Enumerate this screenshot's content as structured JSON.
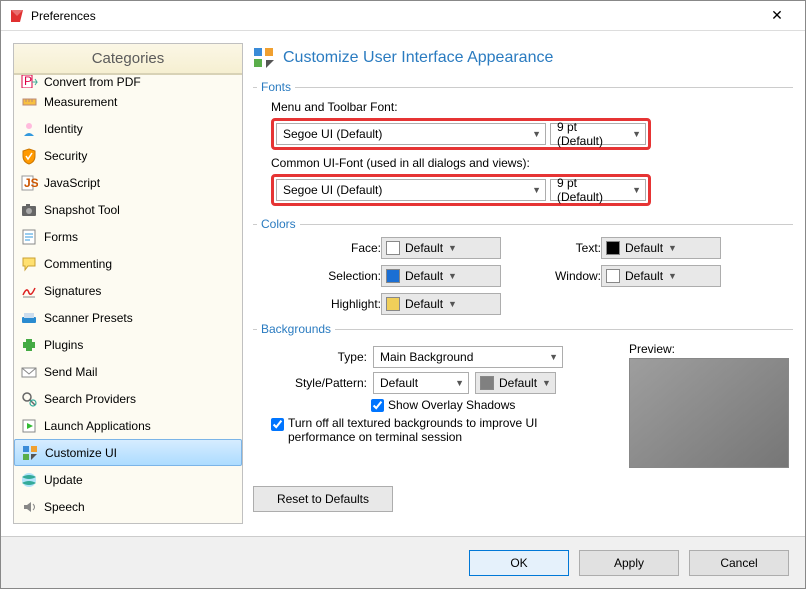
{
  "title": "Preferences",
  "categories_header": "Categories",
  "categories": [
    {
      "id": "convertfrompdf",
      "label": "Convert from PDF",
      "cutoff": true
    },
    {
      "id": "measurement",
      "label": "Measurement"
    },
    {
      "id": "identity",
      "label": "Identity"
    },
    {
      "id": "security",
      "label": "Security"
    },
    {
      "id": "javascript",
      "label": "JavaScript"
    },
    {
      "id": "snapshot",
      "label": "Snapshot Tool"
    },
    {
      "id": "forms",
      "label": "Forms"
    },
    {
      "id": "commenting",
      "label": "Commenting"
    },
    {
      "id": "signatures",
      "label": "Signatures"
    },
    {
      "id": "scanner",
      "label": "Scanner Presets"
    },
    {
      "id": "plugins",
      "label": "Plugins"
    },
    {
      "id": "sendmail",
      "label": "Send Mail"
    },
    {
      "id": "searchproviders",
      "label": "Search Providers"
    },
    {
      "id": "launchapps",
      "label": "Launch Applications"
    },
    {
      "id": "customizeui",
      "label": "Customize UI",
      "selected": true
    },
    {
      "id": "update",
      "label": "Update"
    },
    {
      "id": "speech",
      "label": "Speech"
    }
  ],
  "page_title": "Customize User Interface Appearance",
  "fonts": {
    "title": "Fonts",
    "menu_label": "Menu and Toolbar Font:",
    "menu_font": "Segoe UI (Default)",
    "menu_size": "9 pt (Default)",
    "common_label": "Common UI-Font (used in all dialogs and views):",
    "common_font": "Segoe UI (Default)",
    "common_size": "9 pt (Default)"
  },
  "colors": {
    "title": "Colors",
    "face_label": "Face:",
    "face_value": "Default",
    "face_swatch": "#ffffff",
    "text_label": "Text:",
    "text_value": "Default",
    "text_swatch": "#000000",
    "selection_label": "Selection:",
    "selection_value": "Default",
    "selection_swatch": "#1b6fd4",
    "window_label": "Window:",
    "window_value": "Default",
    "window_swatch": "#ffffff",
    "highlight_label": "Highlight:",
    "highlight_value": "Default",
    "highlight_swatch": "#f0cf5a"
  },
  "backgrounds": {
    "title": "Backgrounds",
    "type_label": "Type:",
    "type_value": "Main Background",
    "style_label": "Style/Pattern:",
    "style_value": "Default",
    "style_color_value": "Default",
    "style_color_swatch": "#808080",
    "overlay_label": "Show Overlay Shadows",
    "overlay_checked": true,
    "turnoff_label": "Turn off all textured backgrounds to improve UI performance on terminal session",
    "turnoff_checked": true,
    "preview_label": "Preview:"
  },
  "reset_label": "Reset to Defaults",
  "buttons": {
    "ok": "OK",
    "apply": "Apply",
    "cancel": "Cancel"
  }
}
